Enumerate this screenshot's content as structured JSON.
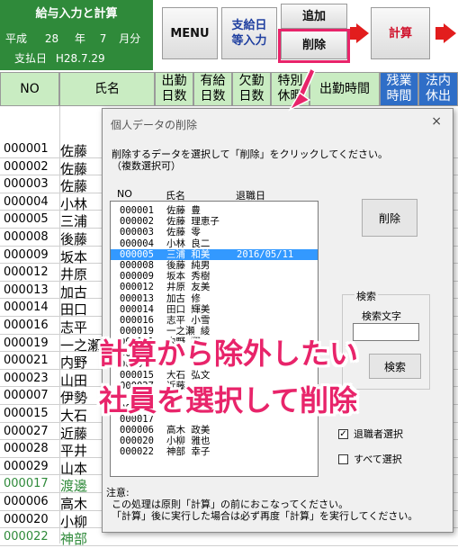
{
  "header": {
    "title": "給与入力と計算",
    "era": "平成",
    "year": "28",
    "year_unit": "年",
    "month": "7",
    "month_unit": "月分",
    "paydate_label": "支払日",
    "paydate": "H28.7.29"
  },
  "toolbar": {
    "menu_label": "MENU",
    "kyuyo_label_1": "支給日",
    "kyuyo_label_2": "等入力",
    "add_label": "追加",
    "delete_label": "削除",
    "calc_label": "計算",
    "arrow_color": "#e21d1d"
  },
  "sheet": {
    "col_no": "NO",
    "col_name": "氏名",
    "col_shukkin_1": "出勤",
    "col_shukkin_2": "日数",
    "col_yukyu_1": "有給",
    "col_yukyu_2": "日数",
    "col_kekkin_1": "欠勤",
    "col_kekkin_2": "日数",
    "col_tokubetsu_1": "特別",
    "col_tokubetsu_2": "休暇",
    "col_jikan": "出勤時間",
    "col_zangyo_1": "残業",
    "col_zangyo_2": "時間",
    "col_hounai_1": "法内",
    "col_hounai_2": "休出",
    "rows": [
      {
        "no": "000001",
        "name": "佐藤"
      },
      {
        "no": "000002",
        "name": "佐藤"
      },
      {
        "no": "000003",
        "name": "佐藤"
      },
      {
        "no": "000004",
        "name": "小林"
      },
      {
        "no": "000005",
        "name": "三浦"
      },
      {
        "no": "000008",
        "name": "後藤"
      },
      {
        "no": "000009",
        "name": "坂本"
      },
      {
        "no": "000012",
        "name": "井原"
      },
      {
        "no": "000013",
        "name": "加古"
      },
      {
        "no": "000014",
        "name": "田口"
      },
      {
        "no": "000016",
        "name": "志平"
      },
      {
        "no": "000019",
        "name": "一之瀬"
      },
      {
        "no": "000021",
        "name": "内野"
      },
      {
        "no": "000023",
        "name": "山田"
      },
      {
        "no": "000007",
        "name": "伊勢"
      },
      {
        "no": "000015",
        "name": "大石"
      },
      {
        "no": "000027",
        "name": "近藤"
      },
      {
        "no": "000028",
        "name": "平井"
      },
      {
        "no": "000029",
        "name": "山本"
      },
      {
        "no": "000017",
        "name": "渡邊",
        "green": true
      },
      {
        "no": "000006",
        "name": "高木"
      },
      {
        "no": "000020",
        "name": "小柳"
      },
      {
        "no": "000022",
        "name": "神部",
        "green": true
      }
    ]
  },
  "dialog": {
    "title": "個人データの削除",
    "close": "×",
    "instruction_1": "削除するデータを選択して「削除」をクリックしてください。",
    "instruction_2": "（複数選択可）",
    "list_header_no": "NO",
    "list_header_name": "氏名",
    "list_header_retire": "退職日",
    "list": [
      {
        "no": "000001",
        "name": "佐藤 豊",
        "retire": ""
      },
      {
        "no": "000002",
        "name": "佐藤 理恵子",
        "retire": ""
      },
      {
        "no": "000003",
        "name": "佐藤 零",
        "retire": ""
      },
      {
        "no": "000004",
        "name": "小林 良二",
        "retire": ""
      },
      {
        "no": "000005",
        "name": "三浦 和美",
        "retire": "2016/05/11",
        "selected": true
      },
      {
        "no": "000008",
        "name": "後藤 純男",
        "retire": ""
      },
      {
        "no": "000009",
        "name": "坂本 秀樹",
        "retire": ""
      },
      {
        "no": "000012",
        "name": "井原 友美",
        "retire": ""
      },
      {
        "no": "000013",
        "name": "加古 修",
        "retire": ""
      },
      {
        "no": "000014",
        "name": "田口 輝美",
        "retire": ""
      },
      {
        "no": "000016",
        "name": "志平 小雪",
        "retire": ""
      },
      {
        "no": "000019",
        "name": "一之瀬 綾",
        "retire": ""
      },
      {
        "no": "000021",
        "name": "内野 翔",
        "retire": ""
      },
      {
        "no": "000023",
        "name": "",
        "retire": ""
      },
      {
        "no": "000007",
        "name": "",
        "retire": ""
      },
      {
        "no": "000015",
        "name": "大石 弘文",
        "retire": ""
      },
      {
        "no": "000027",
        "name": "近藤",
        "retire": ""
      },
      {
        "no": "000028",
        "name": "",
        "retire": ""
      },
      {
        "no": "000029",
        "name": "",
        "retire": ""
      },
      {
        "no": "000017",
        "name": "",
        "retire": ""
      },
      {
        "no": "000006",
        "name": "高木 政美",
        "retire": ""
      },
      {
        "no": "000020",
        "name": "小柳 雅也",
        "retire": ""
      },
      {
        "no": "000022",
        "name": "神部 幸子",
        "retire": ""
      }
    ],
    "delete_button": "削除",
    "search_group": "検索",
    "search_label": "検索文字",
    "search_value": "",
    "search_button": "検索",
    "retired_check": "退職者選択",
    "retired_checked": true,
    "all_check": "すべて選択",
    "all_checked": false,
    "note_title": "注意:",
    "note_1": "この処理は原則「計算」の前におこなってください。",
    "note_2": "「計算」後に実行した場合は必ず再度「計算」を実行してください。"
  },
  "overlay": {
    "line_1": "計算から除外したい",
    "line_2": "社員を選択して削除",
    "accent": "#e8246a"
  }
}
